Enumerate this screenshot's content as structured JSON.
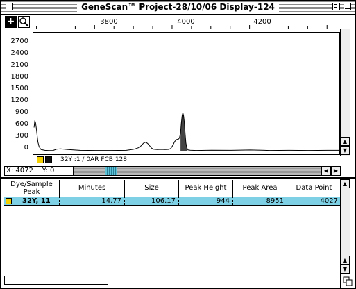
{
  "window": {
    "title": "GeneScan™ Project-28/10/06 Display-124"
  },
  "toolbar": {
    "crosshair_glyph": "+",
    "zoom_glyph": "🔍"
  },
  "ruler": {
    "labels": [
      "3800",
      "4000",
      "4200"
    ]
  },
  "plot": {
    "y_labels": [
      "2700",
      "2400",
      "2100",
      "1800",
      "1500",
      "1200",
      "900",
      "600",
      "300",
      "0"
    ]
  },
  "legend": {
    "sample_label": "32Y :1 / 0AR FCB 128",
    "colors": {
      "yellow": "#f5d000",
      "black": "#111111"
    }
  },
  "coords": {
    "x_label": "X:",
    "x_value": "4072",
    "y_label": "Y:",
    "y_value": "0"
  },
  "table": {
    "headers": {
      "dye": "Dye/Sample\nPeak",
      "minutes": "Minutes",
      "size": "Size",
      "peak_height": "Peak Height",
      "peak_area": "Peak Area",
      "data_point": "Data Point"
    },
    "rows": [
      {
        "dye": "32Y, 11",
        "minutes": "14.77",
        "size": "106.17",
        "peak_height": "944",
        "peak_area": "8951",
        "data_point": "4027"
      }
    ]
  },
  "chart_data": {
    "type": "line",
    "xlim": [
      3640,
      4430
    ],
    "ylim": [
      0,
      2900
    ],
    "ylabel": "",
    "xlabel": "",
    "x_ticks": [
      3800,
      4000,
      4200
    ],
    "y_ticks": [
      0,
      300,
      600,
      900,
      1200,
      1500,
      1800,
      2100,
      2400,
      2700
    ],
    "series": [
      {
        "x": [
          3642,
          3644,
          3646,
          3648,
          3650,
          3652,
          3655,
          3660,
          3670,
          3680,
          3690,
          3700,
          3710,
          3730,
          3760,
          3800,
          3840,
          3880,
          3900,
          3915,
          3920,
          3925,
          3930,
          3935,
          3940,
          3945,
          3950,
          3960,
          3970,
          3980,
          3990,
          3995,
          4000,
          4005,
          4010,
          4015,
          4017,
          4020,
          4022,
          4024,
          4026,
          4027,
          4028,
          4030,
          4032,
          4034,
          4036,
          4038,
          4040,
          4045,
          4050,
          4060,
          4100,
          4150,
          4200,
          4250,
          4300,
          4350,
          4400,
          4430
        ],
        "y": [
          600,
          780,
          720,
          560,
          380,
          220,
          100,
          30,
          10,
          5,
          5,
          40,
          50,
          30,
          10,
          8,
          8,
          10,
          40,
          90,
          150,
          200,
          220,
          190,
          130,
          70,
          40,
          30,
          35,
          30,
          35,
          60,
          140,
          240,
          290,
          300,
          330,
          450,
          700,
          900,
          980,
          944,
          900,
          720,
          430,
          200,
          90,
          40,
          20,
          12,
          10,
          8,
          15,
          10,
          20,
          8,
          10,
          8,
          10,
          10
        ]
      }
    ],
    "shaded_peak": {
      "x_start": 4020,
      "x_end": 4038,
      "label": "32Y, 11"
    }
  }
}
